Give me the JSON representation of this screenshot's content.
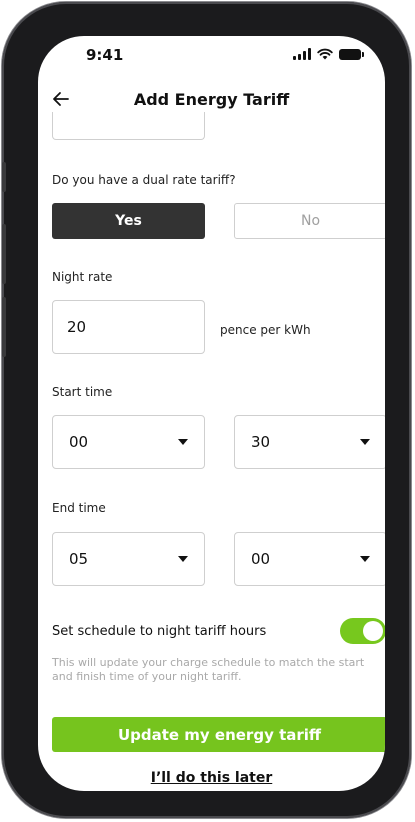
{
  "status_bar": {
    "time": "9:41"
  },
  "nav": {
    "title": "Add Energy Tariff"
  },
  "dual_rate": {
    "question": "Do you have a dual rate tariff?",
    "yes_label": "Yes",
    "no_label": "No",
    "selected": "Yes"
  },
  "night_rate": {
    "label": "Night rate",
    "value": "20",
    "unit": "pence per kWh"
  },
  "start_time": {
    "label": "Start time",
    "hour": "00",
    "minute": "30"
  },
  "end_time": {
    "label": "End time",
    "hour": "05",
    "minute": "00"
  },
  "schedule": {
    "label": "Set schedule to night tariff hours",
    "enabled": true,
    "help": "This will update your charge schedule to match the start and finish time of your night tariff."
  },
  "actions": {
    "primary": "Update my energy tariff",
    "secondary": "I’ll do this later"
  },
  "colors": {
    "accent": "#76c41e",
    "selected_segment": "#333333",
    "muted_text": "#a9a9a9"
  },
  "icons": [
    "back-arrow-icon",
    "chevron-down-icon",
    "signal-icon",
    "wifi-icon",
    "battery-icon"
  ]
}
